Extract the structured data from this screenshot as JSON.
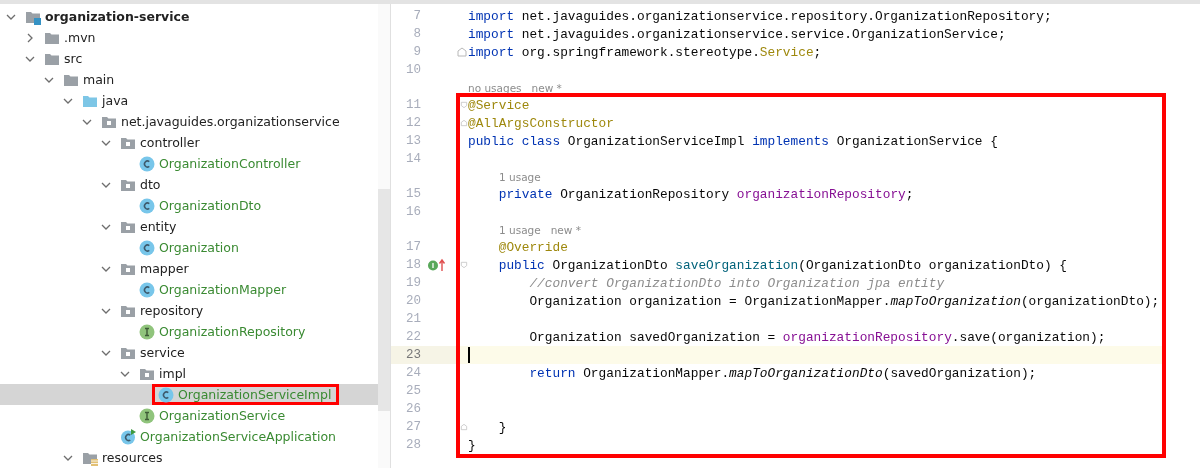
{
  "project_tree": {
    "items": [
      {
        "label": "organization-service",
        "kind": "module",
        "expanded": true,
        "selected": false,
        "children": [
          {
            "label": ".mvn",
            "kind": "folder",
            "expanded": false,
            "selected": false
          },
          {
            "label": "src",
            "kind": "folder",
            "expanded": true,
            "selected": false,
            "children": [
              {
                "label": "main",
                "kind": "folder",
                "expanded": true,
                "selected": false,
                "children": [
                  {
                    "label": "java",
                    "kind": "source_folder",
                    "expanded": true,
                    "selected": false,
                    "children": [
                      {
                        "label": "net.javaguides.organizationservice",
                        "kind": "package",
                        "expanded": true,
                        "selected": false,
                        "children": [
                          {
                            "label": "controller",
                            "kind": "package",
                            "expanded": true,
                            "selected": false,
                            "children": [
                              {
                                "label": "OrganizationController",
                                "kind": "class",
                                "selected": false
                              }
                            ]
                          },
                          {
                            "label": "dto",
                            "kind": "package",
                            "expanded": true,
                            "selected": false,
                            "children": [
                              {
                                "label": "OrganizationDto",
                                "kind": "class",
                                "selected": false
                              }
                            ]
                          },
                          {
                            "label": "entity",
                            "kind": "package",
                            "expanded": true,
                            "selected": false,
                            "children": [
                              {
                                "label": "Organization",
                                "kind": "class",
                                "selected": false
                              }
                            ]
                          },
                          {
                            "label": "mapper",
                            "kind": "package",
                            "expanded": true,
                            "selected": false,
                            "children": [
                              {
                                "label": "OrganizationMapper",
                                "kind": "class",
                                "selected": false
                              }
                            ]
                          },
                          {
                            "label": "repository",
                            "kind": "package",
                            "expanded": true,
                            "selected": false,
                            "children": [
                              {
                                "label": "OrganizationRepository",
                                "kind": "interface",
                                "selected": false
                              }
                            ]
                          },
                          {
                            "label": "service",
                            "kind": "package",
                            "expanded": true,
                            "selected": false,
                            "children": [
                              {
                                "label": "impl",
                                "kind": "package",
                                "expanded": true,
                                "selected": false,
                                "children": [
                                  {
                                    "label": "OrganizationServiceImpl",
                                    "kind": "class",
                                    "selected": true,
                                    "highlighted": true
                                  }
                                ]
                              },
                              {
                                "label": "OrganizationService",
                                "kind": "interface",
                                "selected": false
                              }
                            ]
                          },
                          {
                            "label": "OrganizationServiceApplication",
                            "kind": "app_class",
                            "selected": false
                          }
                        ]
                      }
                    ]
                  },
                  {
                    "label": "resources",
                    "kind": "resources_folder",
                    "expanded": true,
                    "selected": false
                  }
                ]
              }
            ]
          }
        ]
      }
    ]
  },
  "editor": {
    "blocks": [
      {
        "lines": [
          {
            "number": "7",
            "tokens": [
              {
                "kind": "kw",
                "text": "import"
              },
              {
                "kind": "plain",
                "text": " net.javaguides.organizationservice.repository.OrganizationRepository;"
              }
            ]
          },
          {
            "number": "8",
            "tokens": [
              {
                "kind": "kw",
                "text": "import"
              },
              {
                "kind": "plain",
                "text": " net.javaguides.organizationservice.service.OrganizationService;"
              }
            ]
          },
          {
            "number": "9",
            "fold_end": true,
            "tokens": [
              {
                "kind": "kw",
                "text": "import"
              },
              {
                "kind": "plain",
                "text": " org.springframework.stereotype."
              },
              {
                "kind": "annotation",
                "text": "Service"
              },
              {
                "kind": "plain",
                "text": ";"
              }
            ]
          },
          {
            "number": "10"
          }
        ]
      },
      {
        "highlighted": true,
        "lines": [
          {
            "number": "11",
            "hint": "no usages   new *",
            "fold_start": true,
            "tokens": [
              {
                "kind": "annotation",
                "text": "@Service"
              }
            ]
          },
          {
            "number": "12",
            "fold_end": true,
            "tokens": [
              {
                "kind": "annotation",
                "text": "@AllArgsConstructor"
              }
            ]
          },
          {
            "number": "13",
            "tokens": [
              {
                "kind": "kw",
                "text": "public class"
              },
              {
                "kind": "plain",
                "text": " OrganizationServiceImpl "
              },
              {
                "kind": "kw",
                "text": "implements"
              },
              {
                "kind": "plain",
                "text": " OrganizationService {"
              }
            ]
          },
          {
            "number": "14"
          },
          {
            "number": "15",
            "hint": "1 usage",
            "tokens": [
              {
                "kind": "kw",
                "text": "    private"
              },
              {
                "kind": "plain",
                "text": " OrganizationRepository "
              },
              {
                "kind": "field",
                "text": "organizationRepository"
              },
              {
                "kind": "plain",
                "text": ";"
              }
            ]
          },
          {
            "number": "16"
          },
          {
            "number": "17",
            "hint": "1 usage   new *",
            "tokens": [
              {
                "kind": "annotation",
                "text": "    @Override"
              }
            ]
          },
          {
            "number": "18",
            "fold_start": true,
            "implements_marker": true,
            "tokens": [
              {
                "kind": "kw",
                "text": "    public"
              },
              {
                "kind": "plain",
                "text": " OrganizationDto "
              },
              {
                "kind": "decl",
                "text": "saveOrganization"
              },
              {
                "kind": "plain",
                "text": "(OrganizationDto organizationDto) {"
              }
            ]
          },
          {
            "number": "19",
            "tokens": [
              {
                "kind": "comment",
                "text": "        //convert OrganizationDto into Organization jpa entity"
              }
            ]
          },
          {
            "number": "20",
            "tokens": [
              {
                "kind": "plain",
                "text": "        Organization organization = OrganizationMapper."
              },
              {
                "kind": "static",
                "text": "mapToOrganization"
              },
              {
                "kind": "plain",
                "text": "(organizationDto);"
              }
            ]
          },
          {
            "number": "21"
          },
          {
            "number": "22",
            "tokens": [
              {
                "kind": "plain",
                "text": "        Organization savedOrganization = "
              },
              {
                "kind": "field",
                "text": "organizationRepository"
              },
              {
                "kind": "plain",
                "text": ".save(organization);"
              }
            ]
          },
          {
            "number": "23",
            "current": true
          },
          {
            "number": "24",
            "tokens": [
              {
                "kind": "kw",
                "text": "        return"
              },
              {
                "kind": "plain",
                "text": " OrganizationMapper."
              },
              {
                "kind": "static",
                "text": "mapToOrganizationDto"
              },
              {
                "kind": "plain",
                "text": "(savedOrganization);"
              }
            ]
          },
          {
            "number": "25"
          },
          {
            "number": "26"
          },
          {
            "number": "27",
            "fold_end": true,
            "tokens": [
              {
                "kind": "plain",
                "text": "    }"
              }
            ]
          },
          {
            "number": "28",
            "tokens": [
              {
                "kind": "plain",
                "text": "}"
              }
            ]
          }
        ]
      }
    ]
  }
}
